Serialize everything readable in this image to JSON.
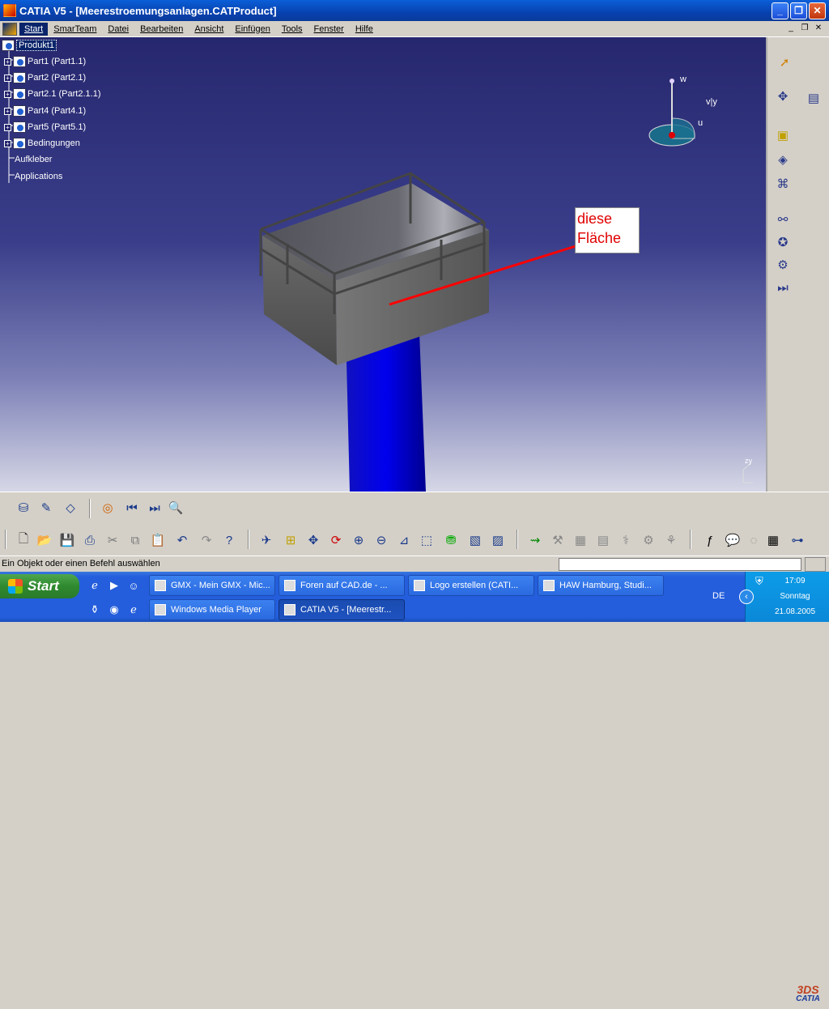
{
  "window": {
    "title": "CATIA V5 - [Meerestroemungsanlagen.CATProduct]"
  },
  "menu": {
    "items": [
      "Start",
      "SmarTeam",
      "Datei",
      "Bearbeiten",
      "Ansicht",
      "Einfügen",
      "Tools",
      "Fenster",
      "Hilfe"
    ]
  },
  "tree": {
    "root": "Produkt1",
    "items": [
      "Part1 (Part1.1)",
      "Part2 (Part2.1)",
      "Part2.1 (Part2.1.1)",
      "Part4 (Part4.1)",
      "Part5 (Part5.1)",
      "Bedingungen",
      "Aufkleber",
      "Applications"
    ]
  },
  "annotation": {
    "line1": "diese",
    "line2": "Fläche"
  },
  "compass": {
    "w": "w",
    "v": "v|y",
    "u": "u"
  },
  "axis": {
    "label": "zy"
  },
  "logo": {
    "text": "CATIA"
  },
  "status": {
    "text": "Ein Objekt oder einen Befehl auswählen",
    "input_value": ""
  },
  "taskbar": {
    "start_label": "Start",
    "row1": [
      "GMX - Mein GMX - Mic...",
      "Foren auf CAD.de - ...",
      "Logo erstellen (CATI...",
      "HAW Hamburg, Studi..."
    ],
    "row2": [
      "Windows Media Player",
      "CATIA V5 - [Meerestr..."
    ],
    "lang": "DE",
    "time": "17:09",
    "day": "Sonntag",
    "date": "21.08.2005"
  },
  "colors": {
    "viewport_top": "#26276e",
    "selection": "#0a246a",
    "annotation_line": "#ff0000",
    "pillar": "#0000e0"
  }
}
